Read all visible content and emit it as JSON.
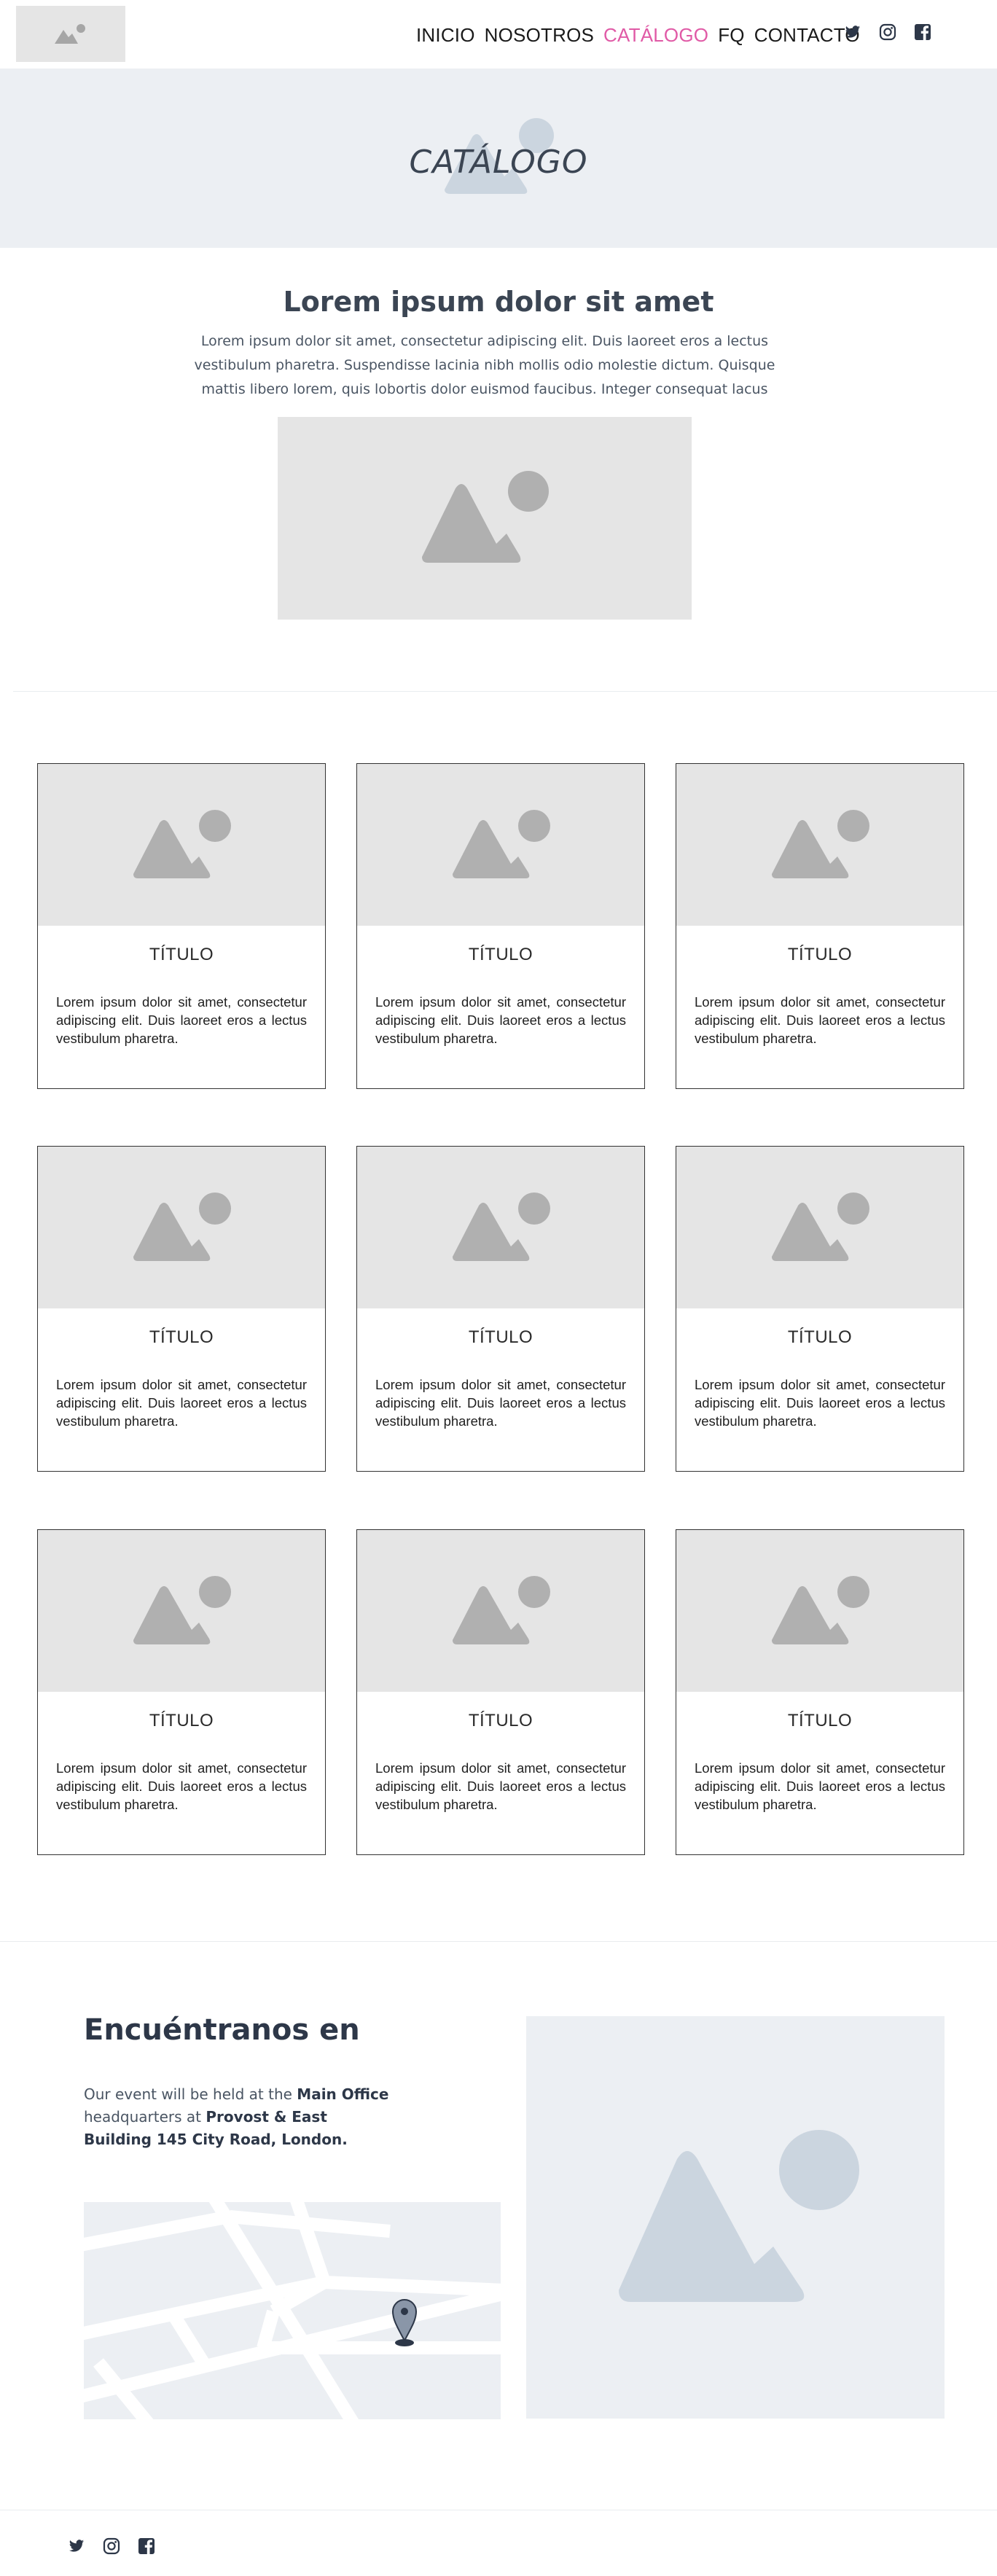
{
  "header": {
    "nav": [
      {
        "label": "INICIO",
        "active": false
      },
      {
        "label": "NOSOTROS",
        "active": false
      },
      {
        "label": "CATÁLOGO",
        "active": true
      },
      {
        "label": "FQ",
        "active": false
      },
      {
        "label": "CONTACTO",
        "active": false
      }
    ],
    "social_icons": [
      "twitter-icon",
      "instagram-icon",
      "facebook-icon"
    ]
  },
  "hero": {
    "title": "CATÁLOGO"
  },
  "intro": {
    "title": "Lorem ipsum dolor sit amet",
    "text": "Lorem ipsum dolor sit amet, consectetur adipiscing elit. Duis laoreet eros a lectus vestibulum pharetra. Suspendisse lacinia nibh mollis odio molestie dictum. Quisque mattis libero lorem, quis lobortis dolor euismod faucibus. Integer consequat lacus"
  },
  "cards": [
    {
      "title": "TÍTULO",
      "text": "Lorem ipsum dolor sit amet, consectetur adipiscing elit. Duis laoreet eros a lectus vestibulum pharetra."
    },
    {
      "title": "TÍTULO",
      "text": "Lorem ipsum dolor sit amet, consectetur adipiscing elit. Duis laoreet eros a lectus vestibulum pharetra."
    },
    {
      "title": "TÍTULO",
      "text": "Lorem ipsum dolor sit amet, consectetur adipiscing elit. Duis laoreet eros a lectus vestibulum pharetra."
    },
    {
      "title": "TÍTULO",
      "text": "Lorem ipsum dolor sit amet, consectetur adipiscing elit. Duis laoreet eros a lectus vestibulum pharetra."
    },
    {
      "title": "TÍTULO",
      "text": "Lorem ipsum dolor sit amet, consectetur adipiscing elit. Duis laoreet eros a lectus vestibulum pharetra."
    },
    {
      "title": "TÍTULO",
      "text": "Lorem ipsum dolor sit amet, consectetur adipiscing elit. Duis laoreet eros a lectus vestibulum pharetra."
    },
    {
      "title": "TÍTULO",
      "text": "Lorem ipsum dolor sit amet, consectetur adipiscing elit. Duis laoreet eros a lectus vestibulum pharetra."
    },
    {
      "title": "TÍTULO",
      "text": "Lorem ipsum dolor sit amet, consectetur adipiscing elit. Duis laoreet eros a lectus vestibulum pharetra."
    },
    {
      "title": "TÍTULO",
      "text": "Lorem ipsum dolor sit amet, consectetur adipiscing elit. Duis laoreet eros a lectus vestibulum pharetra."
    }
  ],
  "find_us": {
    "title": "Encuéntranos en",
    "text_prefix": "Our event will be held at the ",
    "office": "Main Office",
    "text_middle": " headquarters at ",
    "address": "Provost & East Building 145 City Road, London."
  },
  "footer": {
    "social_icons": [
      "twitter-icon",
      "instagram-icon",
      "facebook-icon"
    ]
  },
  "colors": {
    "accent": "#e05aa6",
    "hero_bg": "#eceff3",
    "placeholder_bg": "#e5e5e5",
    "placeholder_icon": "#b0b0b0",
    "text_dark": "#2d3748"
  }
}
